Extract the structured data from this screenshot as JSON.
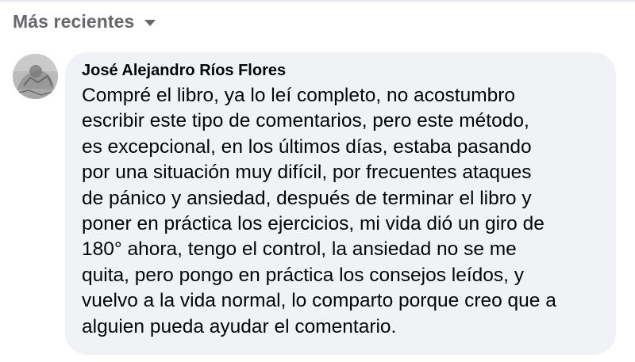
{
  "sort": {
    "label": "Más recientes",
    "icon": "caret-down-icon"
  },
  "comment": {
    "author": "José Alejandro Ríos Flores",
    "avatar_icon": "user-avatar",
    "text": "Compré el libro, ya lo leí completo, no acostumbro\nescribir este tipo de comentarios, pero este método,\nes excepcional, en los últimos días, estaba pasando\npor una situación muy difícil, por frecuentes ataques\nde pánico y ansiedad, después de terminar el libro y\nponer en práctica los ejercicios, mi vida dió un giro de\n180° ahora, tengo el control, la ansiedad no se me\nquita, pero pongo en práctica los consejos leídos, y\nvuelvo a la vida normal, lo comparto porque creo que a\nalguien pueda ayudar el comentario."
  },
  "colors": {
    "bubble_background": "#f0f2f5",
    "secondary_text": "#65676b",
    "primary_text": "#050505"
  }
}
